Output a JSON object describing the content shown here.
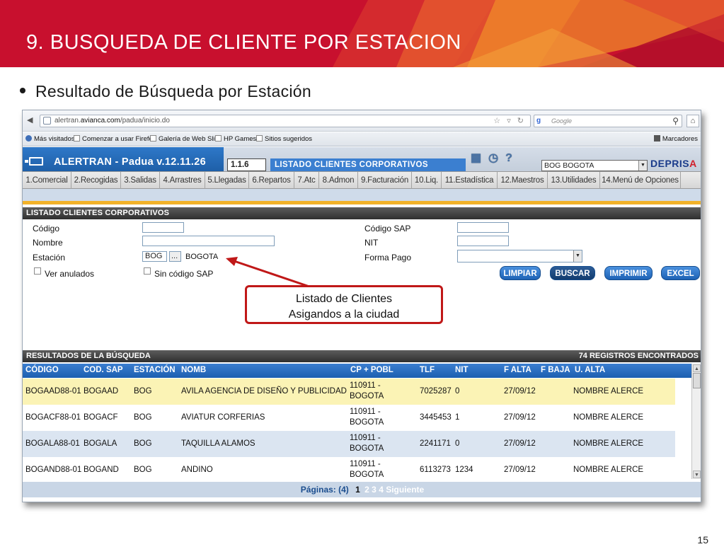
{
  "slide": {
    "title": "9.  BUSQUEDA DE CLIENTE POR ESTACION",
    "bullet": "Resultado de  Búsqueda por  Estación",
    "page_number": "15",
    "callout_line1": "Listado de Clientes",
    "callout_line2": "Asigandos a la ciudad"
  },
  "browser": {
    "url_prefix": "alertran.",
    "url_domain": "avianca.com",
    "url_path": "/padua/inicio.do",
    "search_placeholder": "Google",
    "bookmarks": [
      "Más visitados",
      "Comenzar a usar Firefox",
      "Galería de Web Slice",
      "HP Games",
      "Sitios sugeridos"
    ],
    "bookmarks_right": "Marcadores"
  },
  "app": {
    "name": "ALERTRAN - Padua  v.12.11.26",
    "version_code": "1.1.6",
    "module_title": "LISTADO CLIENTES CORPORATIVOS",
    "station_selected": "BOG BOGOTA",
    "brand": "DEPRIS",
    "brand_accent": "A"
  },
  "menu": [
    "1.Comercial",
    "2.Recogidas",
    "3.Salidas",
    "4.Arrastres",
    "5.Llegadas",
    "6.Repartos",
    "7.Atc",
    "8.Admon",
    "9.Facturación",
    "10.Liq.",
    "11.Estadística",
    "12.Maestros",
    "13.Utilidades",
    "14.Menú de Opciones"
  ],
  "search": {
    "section_title": "LISTADO CLIENTES CORPORATIVOS",
    "labels": {
      "codigo": "Código",
      "nombre": "Nombre",
      "estacion": "Estación",
      "ver_anulados": "Ver anulados",
      "sin_codigo_sap": "Sin código SAP",
      "codigo_sap": "Código SAP",
      "nit": "NIT",
      "forma_pago": "Forma Pago"
    },
    "values": {
      "codigo": "",
      "nombre": "",
      "estacion_code": "BOG",
      "estacion_browse": "...",
      "estacion_name": "BOGOTA",
      "codigo_sap": "",
      "nit": "",
      "forma_pago": ""
    },
    "buttons": {
      "limpiar": "LIMPIAR",
      "buscar": "BUSCAR",
      "imprimir": "IMPRIMIR",
      "excel": "EXCEL"
    }
  },
  "results": {
    "title": "RESULTADOS DE LA BÚSQUEDA",
    "count": "74  REGISTROS ENCONTRADOS",
    "columns": [
      "CÓDIGO",
      "COD. SAP",
      "ESTACIÓN",
      "NOMB",
      "CP + POBL",
      "TLF",
      "NIT",
      "F ALTA",
      "F BAJA",
      "U. ALTA"
    ],
    "rows": [
      {
        "codigo": "BOGAAD88-01",
        "cod_sap": "BOGAAD",
        "estacion": "BOG",
        "nombre": "AVILA AGENCIA DE DISEÑO Y PUBLICIDAD",
        "cp": "110911 -",
        "pobl": "BOGOTA",
        "tlf": "7025287",
        "nit": "0",
        "f_alta": "27/09/12",
        "f_baja": "",
        "u_alta": "NOMBRE ALERCE"
      },
      {
        "codigo": "BOGACF88-01",
        "cod_sap": "BOGACF",
        "estacion": "BOG",
        "nombre": "AVIATUR CORFERIAS",
        "cp": "110911 -",
        "pobl": "BOGOTA",
        "tlf": "3445453",
        "nit": "1",
        "f_alta": "27/09/12",
        "f_baja": "",
        "u_alta": "NOMBRE ALERCE"
      },
      {
        "codigo": "BOGALA88-01",
        "cod_sap": "BOGALA",
        "estacion": "BOG",
        "nombre": "TAQUILLA ALAMOS",
        "cp": "110911 -",
        "pobl": "BOGOTA",
        "tlf": "2241171",
        "nit": "0",
        "f_alta": "27/09/12",
        "f_baja": "",
        "u_alta": "NOMBRE ALERCE"
      },
      {
        "codigo": "BOGAND88-01",
        "cod_sap": "BOGAND",
        "estacion": "BOG",
        "nombre": "ANDINO",
        "cp": "110911 -",
        "pobl": "BOGOTA",
        "tlf": "6113273",
        "nit": "1234",
        "f_alta": "27/09/12",
        "f_baja": "",
        "u_alta": "NOMBRE ALERCE"
      }
    ],
    "pager_label": "Páginas: (4)",
    "current_page": "1",
    "other_pages": "2 3 4 Siguiente"
  },
  "colors": {
    "header_red": "#c8102e",
    "app_blue": "#1e5fa8",
    "row_highlight": "#fbf3b5",
    "row_alt": "#dbe5f1",
    "callout_red": "#c01818"
  }
}
